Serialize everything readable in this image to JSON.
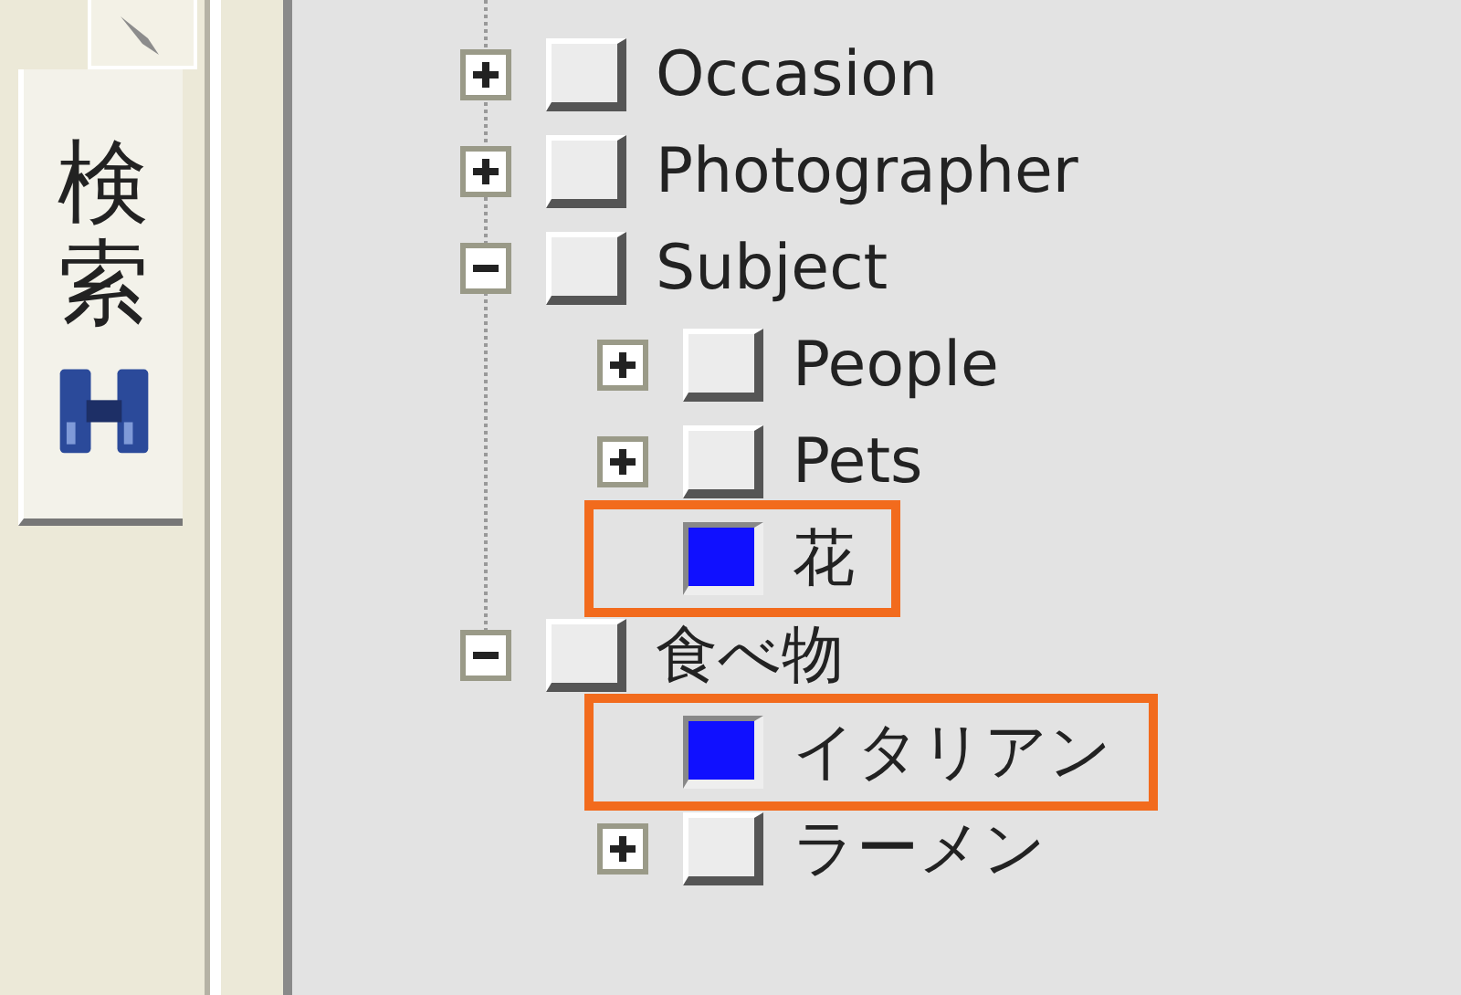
{
  "tabs": [
    {
      "selected": false
    },
    {
      "label": "検索",
      "selected": true
    }
  ],
  "tree": [
    {
      "label": "Occasion",
      "checked": false,
      "expanded": false,
      "highlighted": false
    },
    {
      "label": "Photographer",
      "checked": false,
      "expanded": false,
      "highlighted": false
    },
    {
      "label": "Subject",
      "checked": false,
      "expanded": true,
      "highlighted": false,
      "children": [
        {
          "label": "People",
          "checked": false,
          "expanded": false,
          "highlighted": false
        },
        {
          "label": "Pets",
          "checked": false,
          "expanded": false,
          "highlighted": false
        },
        {
          "label": "花",
          "checked": true,
          "highlighted": true
        }
      ]
    },
    {
      "label": "食べ物",
      "checked": false,
      "expanded": true,
      "highlighted": false,
      "children": [
        {
          "label": "イタリアン",
          "checked": true,
          "highlighted": true
        },
        {
          "label": "ラーメン",
          "checked": false,
          "expanded": false,
          "highlighted": false
        }
      ]
    }
  ]
}
